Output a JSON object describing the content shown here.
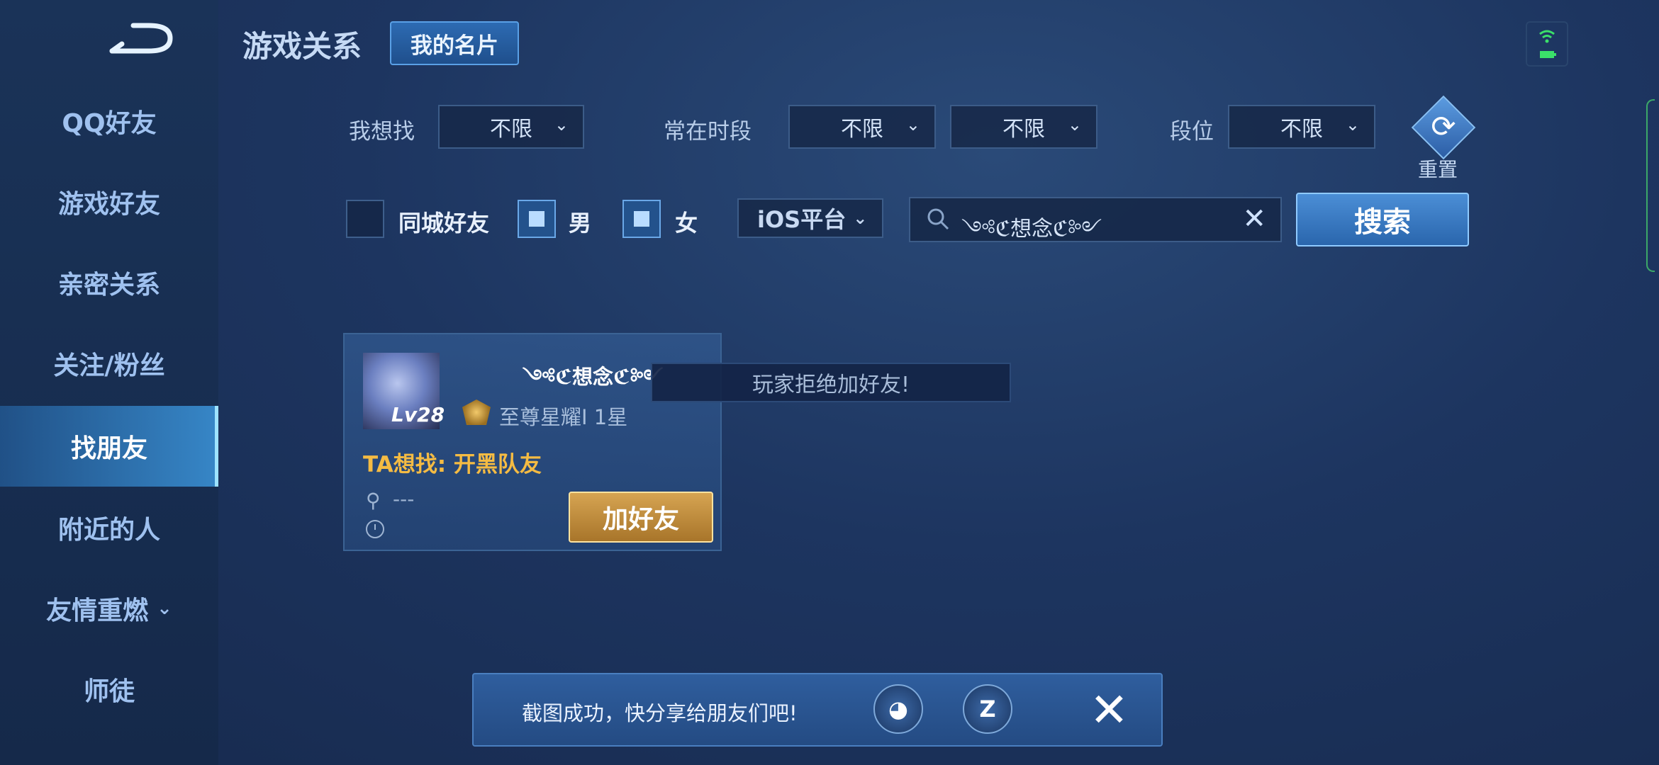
{
  "header": {
    "title": "游戏关系",
    "card_button": "我的名片"
  },
  "sidebar": {
    "items": [
      {
        "label": "QQ好友"
      },
      {
        "label": "游戏好友"
      },
      {
        "label": "亲密关系"
      },
      {
        "label": "关注/粉丝"
      },
      {
        "label": "找朋友",
        "active": true
      },
      {
        "label": "附近的人"
      },
      {
        "label": "友情重燃",
        "has_dropdown": true
      },
      {
        "label": "师徒"
      }
    ]
  },
  "filters": {
    "seek_label": "我想找",
    "seek_value": "不限",
    "time_label": "常在时段",
    "time_value_1": "不限",
    "time_value_2": "不限",
    "rank_label": "段位",
    "rank_value": "不限",
    "reset_label": "重置",
    "same_city_label": "同城好友",
    "same_city_checked": false,
    "male_label": "男",
    "male_checked": true,
    "female_label": "女",
    "female_checked": true,
    "platform_value": "iOS平台"
  },
  "search": {
    "value": "༺ℭ想念ℭ༻",
    "button": "搜索"
  },
  "result_card": {
    "level": "Lv28",
    "player_name": "༺ℭ想念ℭ༻",
    "rank": "至尊星耀Ⅰ 1星",
    "seeking": "TA想找: 开黑队友",
    "location": "---",
    "add_button": "加好友"
  },
  "toast": "玩家拒绝加好友!",
  "share_bar": {
    "text": "截图成功，快分享给朋友们吧!",
    "qq_icon": "qq-penguin-icon",
    "qzone_icon": "qzone-icon"
  },
  "colors": {
    "accent_gold": "#f4bb43",
    "accent_blue": "#4b8ed6",
    "background": "#1d3560"
  }
}
